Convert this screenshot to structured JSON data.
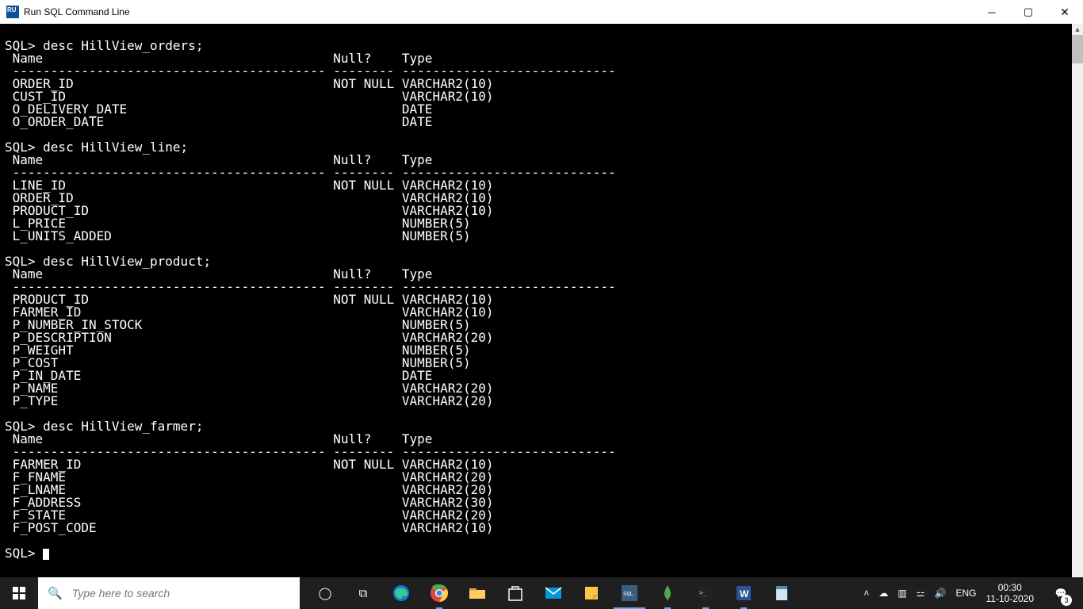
{
  "window": {
    "title": "Run SQL Command Line"
  },
  "prompt": "SQL>",
  "commands": {
    "orders": "desc HillView_orders;",
    "line": "desc HillView_line;",
    "product": "desc HillView_product;",
    "farmer": "desc HillView_farmer;"
  },
  "divider": {
    "name": " ----------------------------------------- ",
    "null": "-------- ",
    "type": "----------------------------"
  },
  "header": {
    "name": " Name",
    "null": "Null?",
    "type": "Type"
  },
  "tables": {
    "orders": [
      {
        "name": " ORDER_ID",
        "null": "NOT NULL",
        "type": "VARCHAR2(10)"
      },
      {
        "name": " CUST_ID",
        "null": "",
        "type": "VARCHAR2(10)"
      },
      {
        "name": " O_DELIVERY_DATE",
        "null": "",
        "type": "DATE"
      },
      {
        "name": " O_ORDER_DATE",
        "null": "",
        "type": "DATE"
      }
    ],
    "line": [
      {
        "name": " LINE_ID",
        "null": "NOT NULL",
        "type": "VARCHAR2(10)"
      },
      {
        "name": " ORDER_ID",
        "null": "",
        "type": "VARCHAR2(10)"
      },
      {
        "name": " PRODUCT_ID",
        "null": "",
        "type": "VARCHAR2(10)"
      },
      {
        "name": " L_PRICE",
        "null": "",
        "type": "NUMBER(5)"
      },
      {
        "name": " L_UNITS_ADDED",
        "null": "",
        "type": "NUMBER(5)"
      }
    ],
    "product": [
      {
        "name": " PRODUCT_ID",
        "null": "NOT NULL",
        "type": "VARCHAR2(10)"
      },
      {
        "name": " FARMER_ID",
        "null": "",
        "type": "VARCHAR2(10)"
      },
      {
        "name": " P_NUMBER_IN_STOCK",
        "null": "",
        "type": "NUMBER(5)"
      },
      {
        "name": " P_DESCRIPTION",
        "null": "",
        "type": "VARCHAR2(20)"
      },
      {
        "name": " P_WEIGHT",
        "null": "",
        "type": "NUMBER(5)"
      },
      {
        "name": " P_COST",
        "null": "",
        "type": "NUMBER(5)"
      },
      {
        "name": " P_IN_DATE",
        "null": "",
        "type": "DATE"
      },
      {
        "name": " P_NAME",
        "null": "",
        "type": "VARCHAR2(20)"
      },
      {
        "name": " P_TYPE",
        "null": "",
        "type": "VARCHAR2(20)"
      }
    ],
    "farmer": [
      {
        "name": " FARMER_ID",
        "null": "NOT NULL",
        "type": "VARCHAR2(10)"
      },
      {
        "name": " F_FNAME",
        "null": "",
        "type": "VARCHAR2(20)"
      },
      {
        "name": " F_LNAME",
        "null": "",
        "type": "VARCHAR2(20)"
      },
      {
        "name": " F_ADDRESS",
        "null": "",
        "type": "VARCHAR2(30)"
      },
      {
        "name": " F_STATE",
        "null": "",
        "type": "VARCHAR2(20)"
      },
      {
        "name": " F_POST_CODE",
        "null": "",
        "type": "VARCHAR2(10)"
      }
    ]
  },
  "taskbar": {
    "search_placeholder": "Type here to search",
    "language": "ENG",
    "time": "00:30",
    "date": "11-10-2020",
    "notif_count": "3"
  }
}
